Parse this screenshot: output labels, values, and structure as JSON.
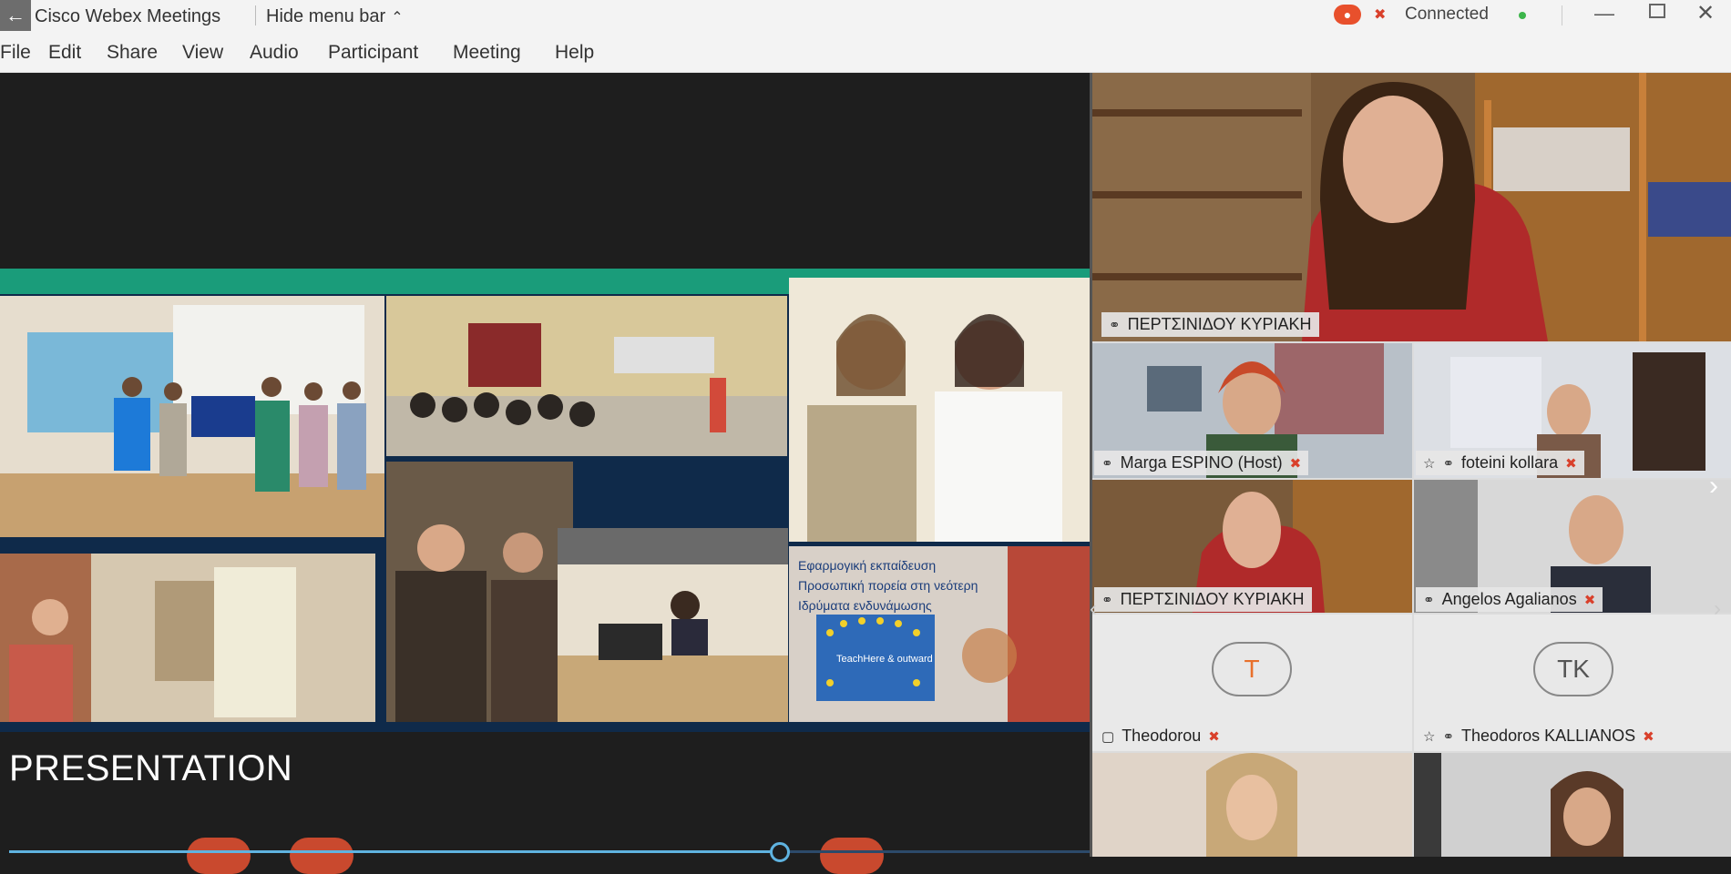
{
  "titlebar": {
    "back_icon": "back-arrow-icon",
    "app_title": "Cisco Webex Meetings",
    "hide_menu_label": "Hide menu bar",
    "chevron_up": "^",
    "connection_status": "Connected",
    "status_color": "#3cb54a",
    "record_color": "#e8502c"
  },
  "menu": {
    "items": [
      "File",
      "Edit",
      "Share",
      "View",
      "Audio",
      "Participant",
      "Meeting",
      "Help"
    ]
  },
  "presentation": {
    "slide_label": "PRESENTATION",
    "banner_lines": [
      "Εφαρμογική εκπαίδευση",
      "Προσωπική πορεία στη νεότερη",
      "Ιδρύματα ενδυνάμωσης"
    ],
    "badge_text": "TeachHere & outward"
  },
  "participants": {
    "active_speaker": "ΠΕΡΤΣΙΝΙΔΟΥ ΚΥΡΙΑΚΗ",
    "tiles": [
      {
        "name": "Marga ESPINO (Host)",
        "muted": true
      },
      {
        "name": "foteini kollara",
        "muted": true
      },
      {
        "name": "ΠΕΡΤΣΙΝΙΔΟΥ ΚΥΡΙΑΚΗ",
        "muted": false
      },
      {
        "name": "Angelos Agalianos",
        "muted": true
      },
      {
        "name": "Theodorou",
        "initials": "T",
        "muted": true
      },
      {
        "name": "Theodoros KALLIANOS",
        "initials": "TK",
        "muted": true
      }
    ]
  },
  "colors": {
    "accent_blue": "#1a8cd8",
    "slide_teal": "#1a9c7a",
    "mute_red": "#d9402b"
  }
}
